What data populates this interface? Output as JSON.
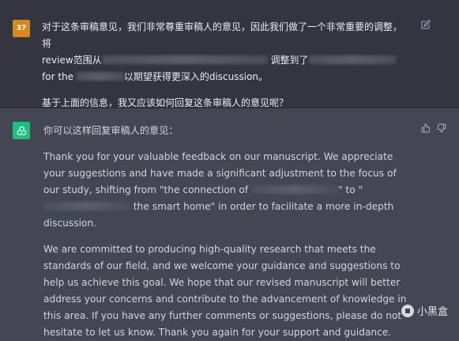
{
  "user_message": {
    "avatar_label": "37",
    "line1": "对于这条审稿意见，我们非常尊重审稿人的意见，因此我们做了一个非常重要的调整，将",
    "line2_a": "review范围从",
    "line2_b": "调整到了",
    "line3_a": "for the",
    "line3_b": "以期望获得更深入的discussion。",
    "question": "基于上面的信息，我又应该如何回复这条审稿人的意见呢？"
  },
  "assistant_message": {
    "intro": "你可以这样回复审稿人的意见：",
    "para1_a": "Thank you for your valuable feedback on our manuscript. We appreciate your suggestions and have made a significant adjustment to the focus of our study, shifting from \"the connection of",
    "para1_b": "\" to \"",
    "para1_c": "the smart home\" in order to facilitate a more in-depth discussion.",
    "para2": "We are committed to producing high-quality research that meets the standards of our field, and we welcome your guidance and suggestions to help us achieve this goal. We hope that our revised manuscript will better address your concerns and contribute to the advancement of knowledge in this area. If you have any further comments or suggestions, please do not hesitate to let us know. Thank you again for your support and guidance."
  },
  "watermark": {
    "text": "小黑盒"
  },
  "icons": {
    "edit": "edit-icon",
    "thumbs_up": "thumbs-up-icon",
    "thumbs_down": "thumbs-down-icon",
    "assistant_logo": "openai-logo-icon",
    "watermark_logo": "xiaoheihe-logo-icon"
  },
  "colors": {
    "user_bg": "#343541",
    "assistant_bg": "#444654",
    "user_avatar": "#d9881a",
    "assistant_avatar": "#19c37d"
  }
}
